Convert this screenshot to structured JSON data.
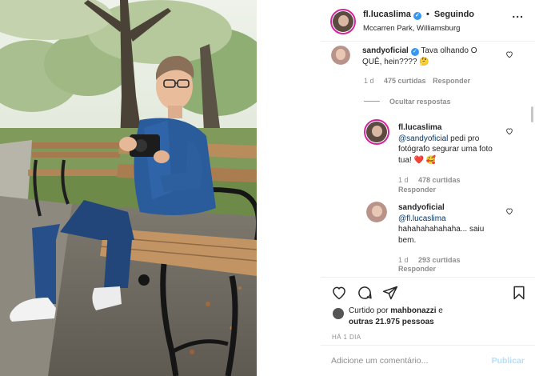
{
  "post": {
    "photo_alt": "Man with glasses in a blue denim outfit sitting on a wooden park bench under trees"
  },
  "header": {
    "username": "fl.lucaslima",
    "separator": "•",
    "follow_status": "Seguindo",
    "location": "Mccarren Park, Williamsburg",
    "more": "..."
  },
  "comments": [
    {
      "username": "sandyoficial",
      "text": "Tava olhando O QUÊ, hein???? 🤔",
      "age": "1 d",
      "likes": "475 curtidas",
      "reply": "Responder"
    }
  ],
  "hide_replies": "Ocultar respostas",
  "replies": [
    {
      "username": "fl.lucaslima",
      "mention": "@sandyoficial",
      "text": " pedi pro fotógrafo segurar uma foto tua! ❤️ 🥰",
      "age": "1 d",
      "likes": "478 curtidas",
      "reply": "Responder"
    },
    {
      "username": "sandyoficial",
      "mention": "@fl.lucaslima",
      "text": " hahahahahahaha... saiu bem.",
      "age": "1 d",
      "likes": "293 curtidas",
      "reply": "Responder"
    }
  ],
  "likes": {
    "prefix": "Curtido por ",
    "user": "mahbonazzi",
    "mid": " e ",
    "others": "outras 21.975 pessoas"
  },
  "timestamp": "HÁ 1 DIA",
  "add_comment": {
    "placeholder": "Adicione um comentário...",
    "publish": "Publicar"
  },
  "colors": {
    "link": "#00376b",
    "verified": "#3897f0",
    "like_heart": "#262626",
    "publish_disabled": "#b2dffc"
  }
}
